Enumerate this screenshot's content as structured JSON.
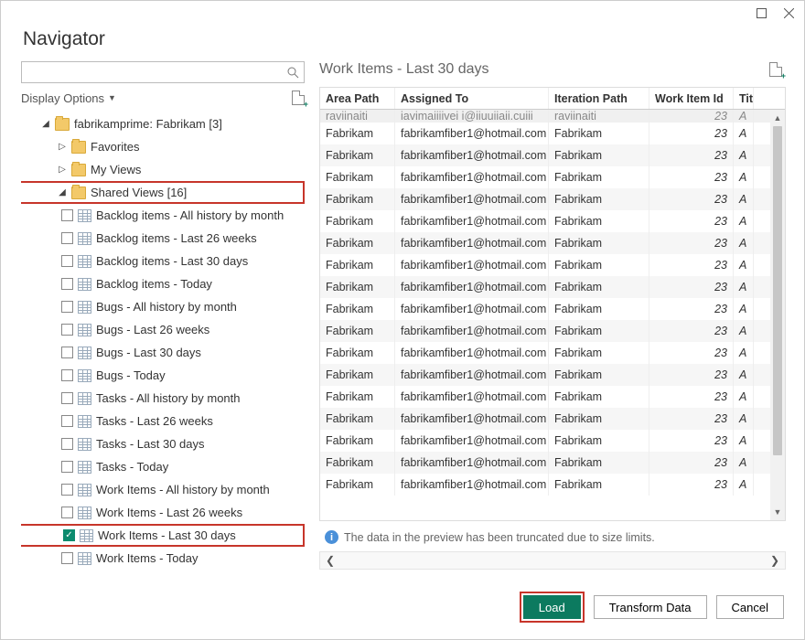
{
  "window": {
    "title": "Navigator"
  },
  "search": {
    "placeholder": ""
  },
  "display_options_label": "Display Options",
  "tree": {
    "root": {
      "label": "fabrikamprime: Fabrikam [3]"
    },
    "favorites": {
      "label": "Favorites"
    },
    "myviews": {
      "label": "My Views"
    },
    "shared": {
      "label": "Shared Views [16]"
    },
    "items": [
      "Backlog items - All history by month",
      "Backlog items - Last 26 weeks",
      "Backlog items - Last 30 days",
      "Backlog items - Today",
      "Bugs - All history by month",
      "Bugs - Last 26 weeks",
      "Bugs - Last 30 days",
      "Bugs - Today",
      "Tasks - All history by month",
      "Tasks - Last 26 weeks",
      "Tasks - Last 30 days",
      "Tasks - Today",
      "Work Items - All history by month",
      "Work Items - Last 26 weeks",
      "Work Items - Last 30 days",
      "Work Items - Today"
    ],
    "selected_index": 14
  },
  "preview": {
    "title": "Work Items - Last 30 days",
    "columns": [
      "Area Path",
      "Assigned To",
      "Iteration Path",
      "Work Item Id",
      "Title"
    ],
    "truncated_first_row": {
      "area": "raviinaiti",
      "assigned": "iavimaiiiivei i@iiuuiiaii.cuiii",
      "iter": "raviinaiti",
      "wid": "23",
      "title": "A"
    },
    "rows": [
      {
        "area": "Fabrikam",
        "assigned": "fabrikamfiber1@hotmail.com",
        "iter": "Fabrikam",
        "wid": "23",
        "title": "A"
      },
      {
        "area": "Fabrikam",
        "assigned": "fabrikamfiber1@hotmail.com",
        "iter": "Fabrikam",
        "wid": "23",
        "title": "A"
      },
      {
        "area": "Fabrikam",
        "assigned": "fabrikamfiber1@hotmail.com",
        "iter": "Fabrikam",
        "wid": "23",
        "title": "A"
      },
      {
        "area": "Fabrikam",
        "assigned": "fabrikamfiber1@hotmail.com",
        "iter": "Fabrikam",
        "wid": "23",
        "title": "A"
      },
      {
        "area": "Fabrikam",
        "assigned": "fabrikamfiber1@hotmail.com",
        "iter": "Fabrikam",
        "wid": "23",
        "title": "A"
      },
      {
        "area": "Fabrikam",
        "assigned": "fabrikamfiber1@hotmail.com",
        "iter": "Fabrikam",
        "wid": "23",
        "title": "A"
      },
      {
        "area": "Fabrikam",
        "assigned": "fabrikamfiber1@hotmail.com",
        "iter": "Fabrikam",
        "wid": "23",
        "title": "A"
      },
      {
        "area": "Fabrikam",
        "assigned": "fabrikamfiber1@hotmail.com",
        "iter": "Fabrikam",
        "wid": "23",
        "title": "A"
      },
      {
        "area": "Fabrikam",
        "assigned": "fabrikamfiber1@hotmail.com",
        "iter": "Fabrikam",
        "wid": "23",
        "title": "A"
      },
      {
        "area": "Fabrikam",
        "assigned": "fabrikamfiber1@hotmail.com",
        "iter": "Fabrikam",
        "wid": "23",
        "title": "A"
      },
      {
        "area": "Fabrikam",
        "assigned": "fabrikamfiber1@hotmail.com",
        "iter": "Fabrikam",
        "wid": "23",
        "title": "A"
      },
      {
        "area": "Fabrikam",
        "assigned": "fabrikamfiber1@hotmail.com",
        "iter": "Fabrikam",
        "wid": "23",
        "title": "A"
      },
      {
        "area": "Fabrikam",
        "assigned": "fabrikamfiber1@hotmail.com",
        "iter": "Fabrikam",
        "wid": "23",
        "title": "A"
      },
      {
        "area": "Fabrikam",
        "assigned": "fabrikamfiber1@hotmail.com",
        "iter": "Fabrikam",
        "wid": "23",
        "title": "A"
      },
      {
        "area": "Fabrikam",
        "assigned": "fabrikamfiber1@hotmail.com",
        "iter": "Fabrikam",
        "wid": "23",
        "title": "A"
      },
      {
        "area": "Fabrikam",
        "assigned": "fabrikamfiber1@hotmail.com",
        "iter": "Fabrikam",
        "wid": "23",
        "title": "A"
      },
      {
        "area": "Fabrikam",
        "assigned": "fabrikamfiber1@hotmail.com",
        "iter": "Fabrikam",
        "wid": "23",
        "title": "A"
      }
    ],
    "info": "The data in the preview has been truncated due to size limits."
  },
  "buttons": {
    "load": "Load",
    "transform": "Transform Data",
    "cancel": "Cancel"
  }
}
